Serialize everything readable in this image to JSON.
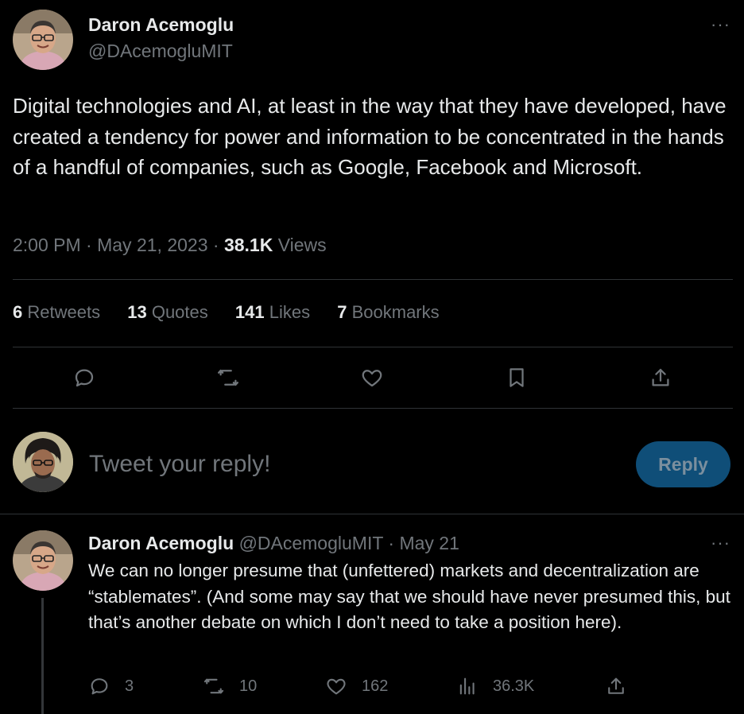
{
  "tweet": {
    "author_name": "Daron Acemoglu",
    "author_handle": "@DAcemogluMIT",
    "more": "···",
    "text": "Digital technologies and AI, at least in the way that they have developed, have created a tendency for power and information to be concentrated in the hands of a handful of companies, such as Google, Facebook and Microsoft.",
    "time": "2:00 PM",
    "sep": "·",
    "date": "May 21, 2023",
    "views_count": "38.1K",
    "views_label": "Views"
  },
  "stats": [
    {
      "count": "6",
      "label": "Retweets"
    },
    {
      "count": "13",
      "label": "Quotes"
    },
    {
      "count": "141",
      "label": "Likes"
    },
    {
      "count": "7",
      "label": "Bookmarks"
    }
  ],
  "actions": {
    "reply_icon": "reply-icon",
    "retweet_icon": "retweet-icon",
    "like_icon": "heart-icon",
    "bookmark_icon": "bookmark-icon",
    "share_icon": "share-icon"
  },
  "compose": {
    "placeholder": "Tweet your reply!",
    "button_label": "Reply"
  },
  "thread": {
    "author_name": "Daron Acemoglu",
    "author_handle": "@DAcemogluMIT",
    "sep": "·",
    "date": "May 21",
    "more": "···",
    "text": "We can no longer presume that (unfettered) markets and decentralization are “stablemates”. (And some may say that we should have never presumed this, but that’s another debate on which I don’t need to take a position here).",
    "replies": "3",
    "retweets": "10",
    "likes": "162",
    "views": "36.3K"
  },
  "colors": {
    "background": "#000000",
    "text": "#e7e9ea",
    "muted": "#71767b",
    "divider": "#2f3336",
    "reply_button_bg": "#0f4e78"
  }
}
